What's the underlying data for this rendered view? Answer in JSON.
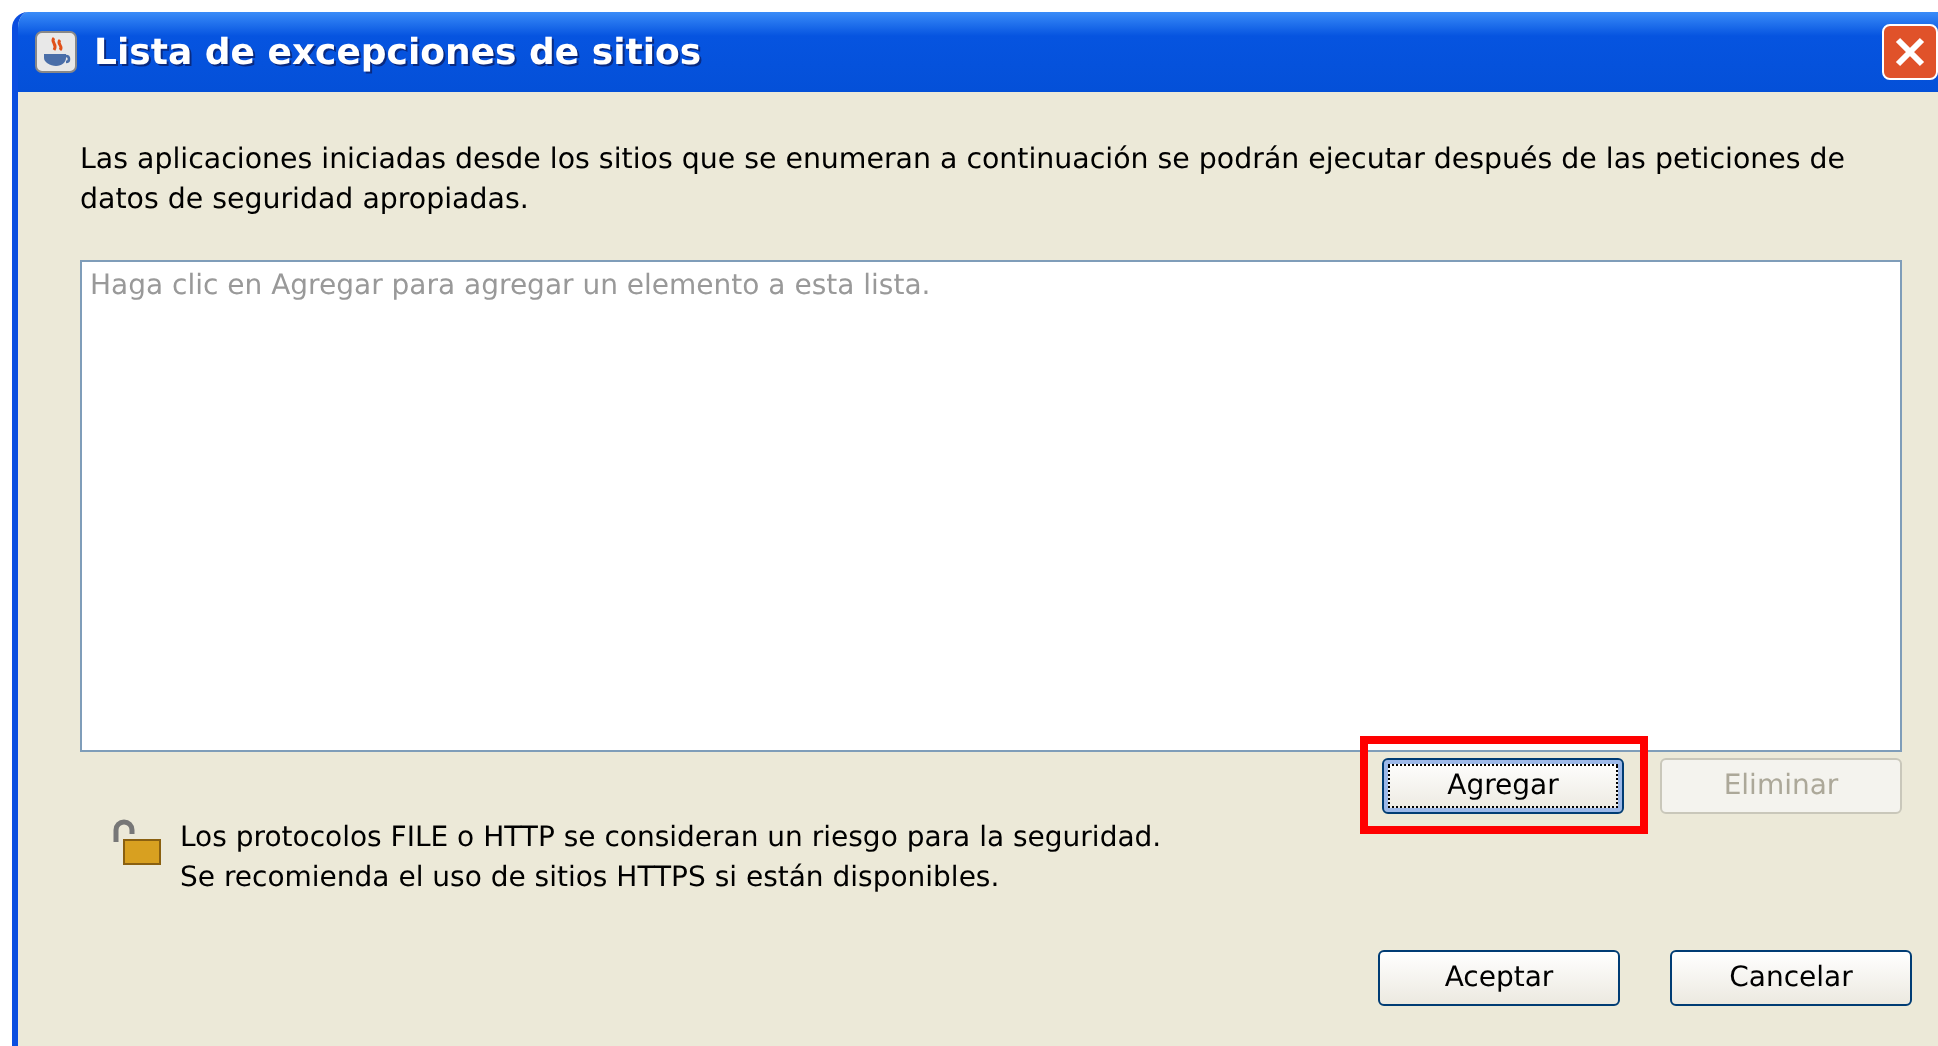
{
  "window": {
    "title": "Lista de excepciones de sitios"
  },
  "description": "Las aplicaciones iniciadas desde los sitios que se enumeran a continuación se podrán ejecutar después de las peticiones de datos de seguridad apropiadas.",
  "site_list": {
    "placeholder": "Haga clic en Agregar para agregar un elemento a esta lista."
  },
  "list_buttons": [
    {
      "label": "Agregar",
      "disabled": false,
      "highlighted": true
    },
    {
      "label": "Eliminar",
      "disabled": true,
      "highlighted": false
    }
  ],
  "warning": [
    "Los protocolos FILE o HTTP se consideran un riesgo para la seguridad.",
    "Se recomienda el uso de sitios HTTPS si están disponibles."
  ],
  "dialog_buttons": [
    "Aceptar",
    "Cancelar"
  ]
}
